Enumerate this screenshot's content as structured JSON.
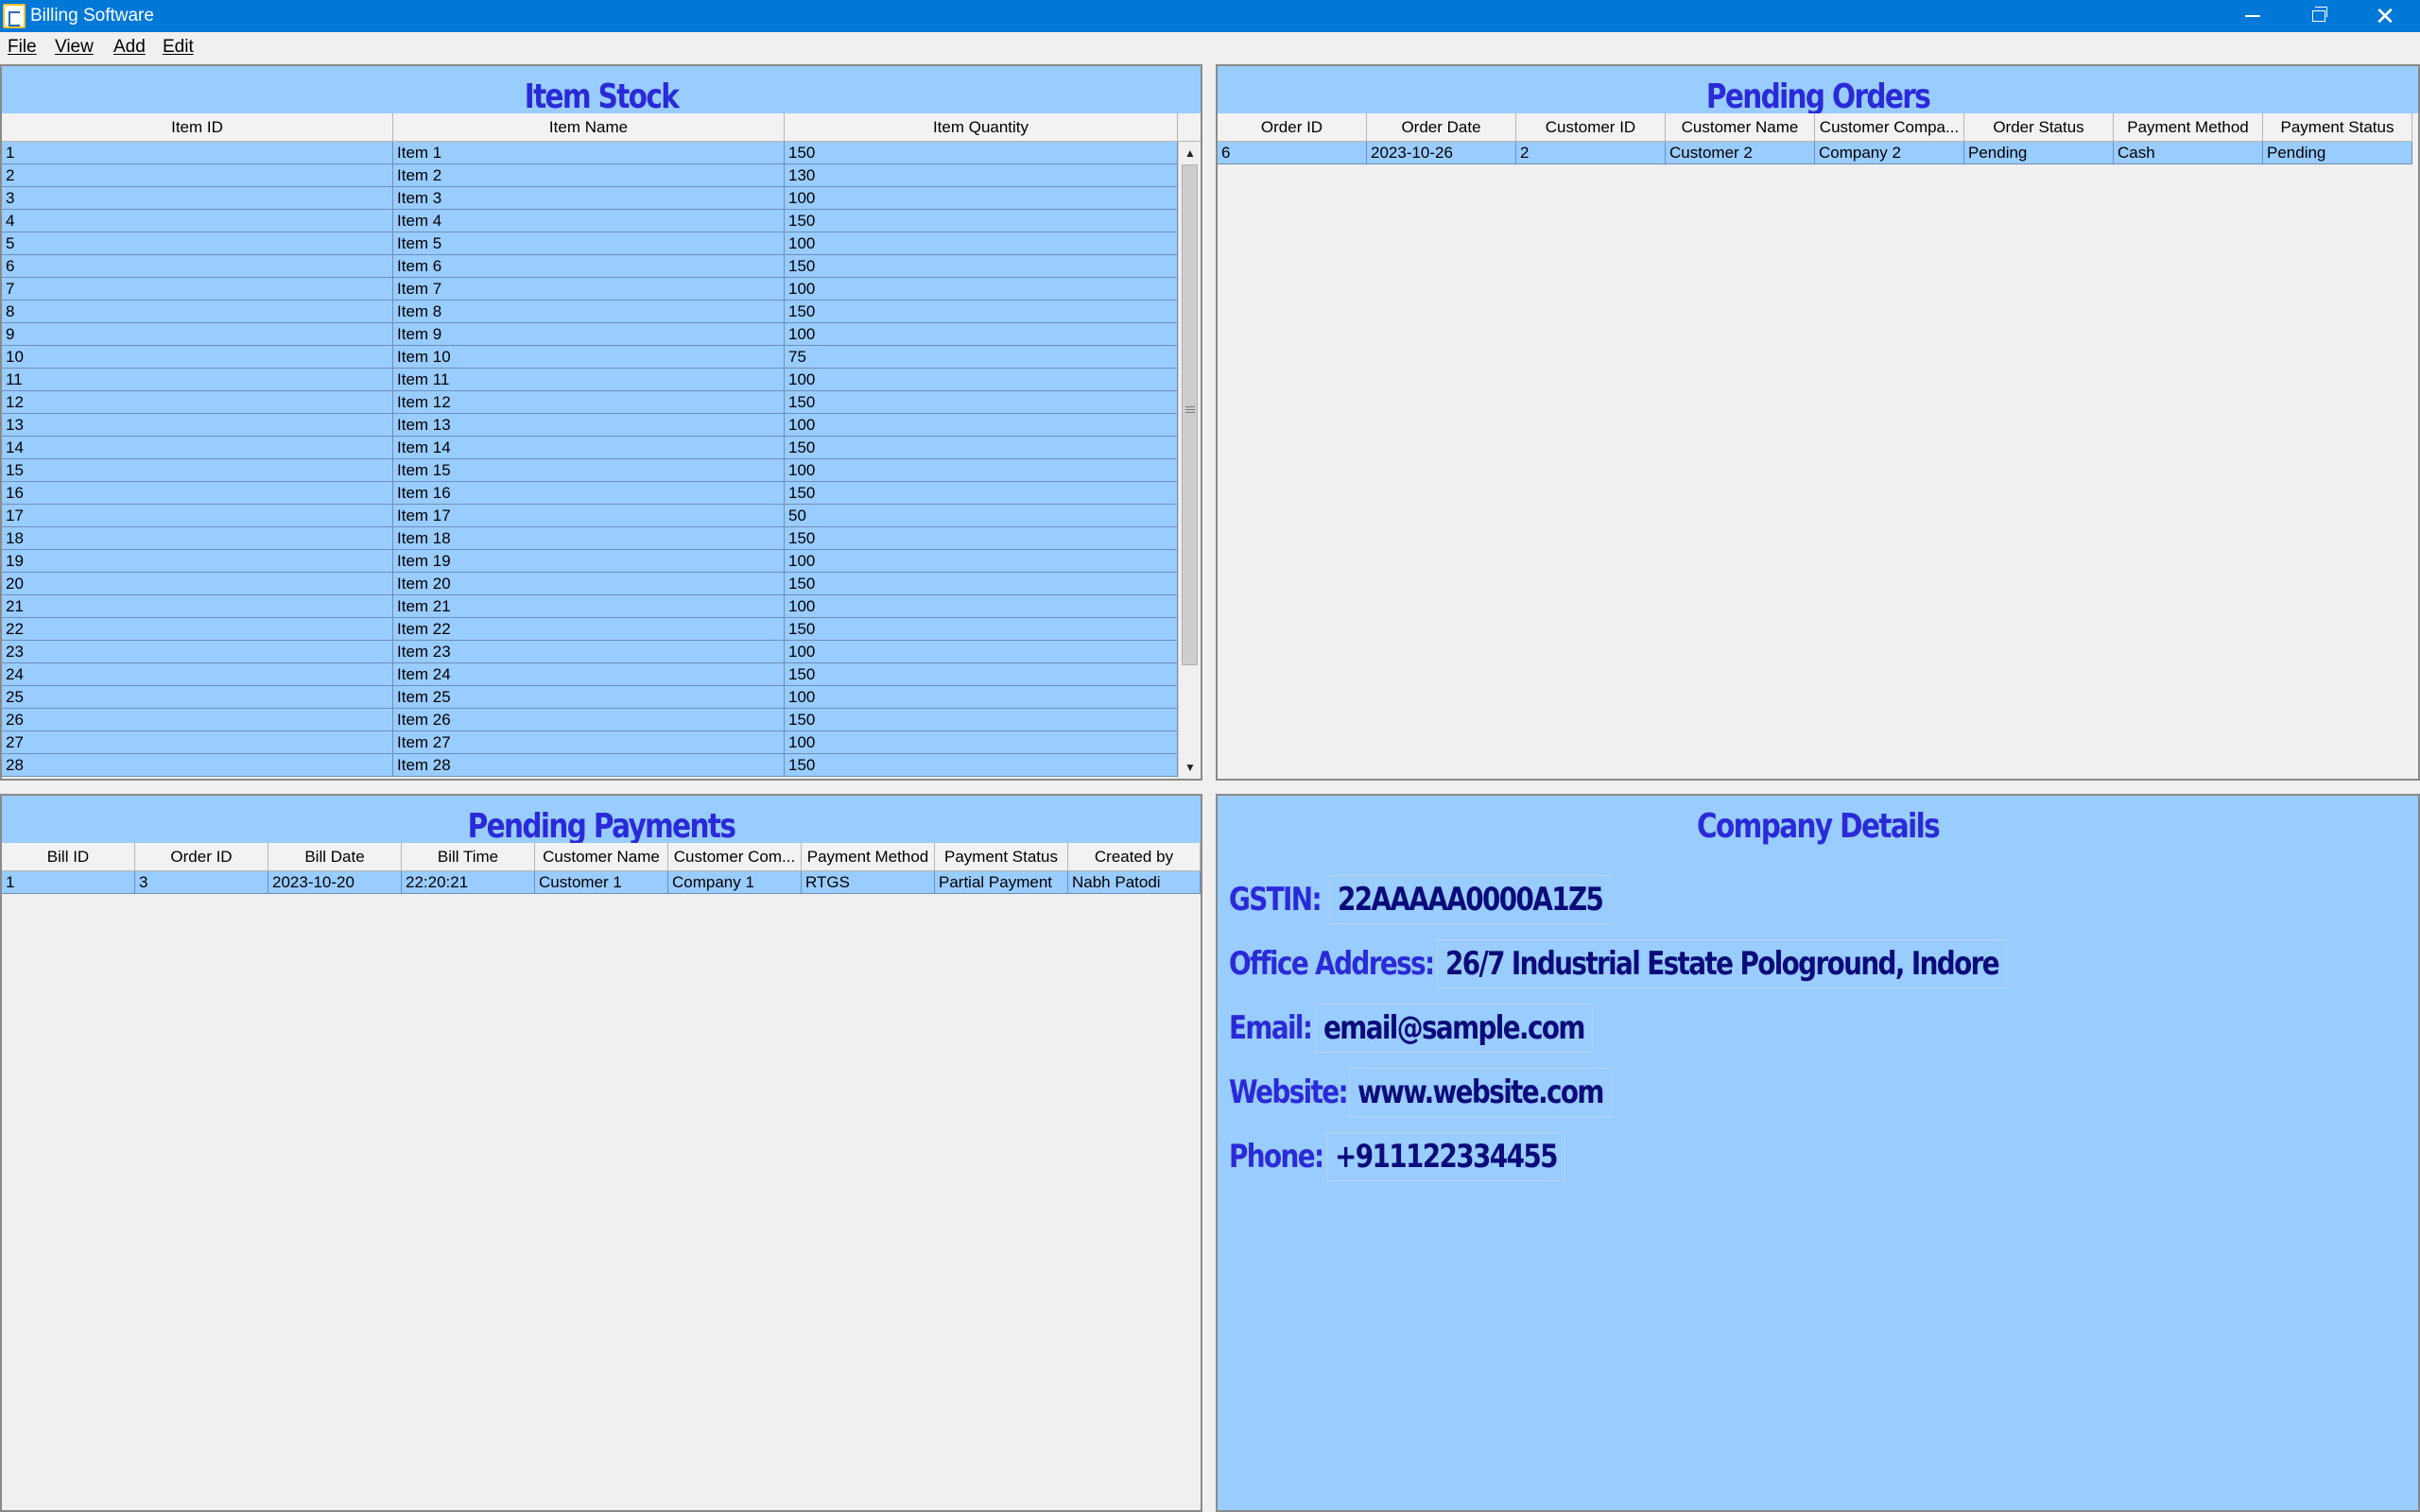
{
  "window": {
    "title": "Billing Software"
  },
  "menu": {
    "file": "File",
    "view": "View",
    "add": "Add",
    "edit": "Edit"
  },
  "item_stock": {
    "title": "Item Stock",
    "columns": [
      "Item ID",
      "Item Name",
      "Item Quantity"
    ],
    "rows": [
      [
        "1",
        "Item 1",
        "150"
      ],
      [
        "2",
        "Item 2",
        "130"
      ],
      [
        "3",
        "Item 3",
        "100"
      ],
      [
        "4",
        "Item 4",
        "150"
      ],
      [
        "5",
        "Item 5",
        "100"
      ],
      [
        "6",
        "Item 6",
        "150"
      ],
      [
        "7",
        "Item 7",
        "100"
      ],
      [
        "8",
        "Item 8",
        "150"
      ],
      [
        "9",
        "Item 9",
        "100"
      ],
      [
        "10",
        "Item 10",
        "75"
      ],
      [
        "11",
        "Item 11",
        "100"
      ],
      [
        "12",
        "Item 12",
        "150"
      ],
      [
        "13",
        "Item 13",
        "100"
      ],
      [
        "14",
        "Item 14",
        "150"
      ],
      [
        "15",
        "Item 15",
        "100"
      ],
      [
        "16",
        "Item 16",
        "150"
      ],
      [
        "17",
        "Item 17",
        "50"
      ],
      [
        "18",
        "Item 18",
        "150"
      ],
      [
        "19",
        "Item 19",
        "100"
      ],
      [
        "20",
        "Item 20",
        "150"
      ],
      [
        "21",
        "Item 21",
        "100"
      ],
      [
        "22",
        "Item 22",
        "150"
      ],
      [
        "23",
        "Item 23",
        "100"
      ],
      [
        "24",
        "Item 24",
        "150"
      ],
      [
        "25",
        "Item 25",
        "100"
      ],
      [
        "26",
        "Item 26",
        "150"
      ],
      [
        "27",
        "Item 27",
        "100"
      ],
      [
        "28",
        "Item 28",
        "150"
      ]
    ]
  },
  "pending_orders": {
    "title": "Pending Orders",
    "columns": [
      "Order ID",
      "Order Date",
      "Customer ID",
      "Customer Name",
      "Customer Compa...",
      "Order Status",
      "Payment Method",
      "Payment Status"
    ],
    "rows": [
      [
        "6",
        "2023-10-26",
        "2",
        "Customer 2",
        "Company 2",
        "Pending",
        "Cash",
        "Pending"
      ]
    ]
  },
  "pending_payments": {
    "title": "Pending Payments",
    "columns": [
      "Bill ID",
      "Order ID",
      "Bill Date",
      "Bill Time",
      "Customer Name",
      "Customer Com...",
      "Payment Method",
      "Payment Status",
      "Created by"
    ],
    "rows": [
      [
        "1",
        "3",
        "2023-10-20",
        "22:20:21",
        "Customer 1",
        "Company 1",
        "RTGS",
        "Partial Payment",
        "Nabh Patodi"
      ]
    ]
  },
  "company_details": {
    "title": "Company Details",
    "gstin_label": "GSTIN:",
    "gstin": "22AAAAA0000A1Z5",
    "address_label": "Office Address:",
    "address": "26/7 Industrial Estate Pologround, Indore",
    "email_label": "Email:",
    "email": "email@sample.com",
    "website_label": "Website:",
    "website": "www.website.com",
    "phone_label": "Phone:",
    "phone": "+911122334455"
  },
  "icons": {
    "app": "billing-app-icon",
    "minimize": "minimize-icon",
    "maximize": "restore-icon",
    "close": "close-icon"
  },
  "colors": {
    "titlebar": "#0078d7",
    "panel_bg": "#99ccff",
    "heading": "#2a2ad8",
    "value_text": "#0b0b7a"
  }
}
